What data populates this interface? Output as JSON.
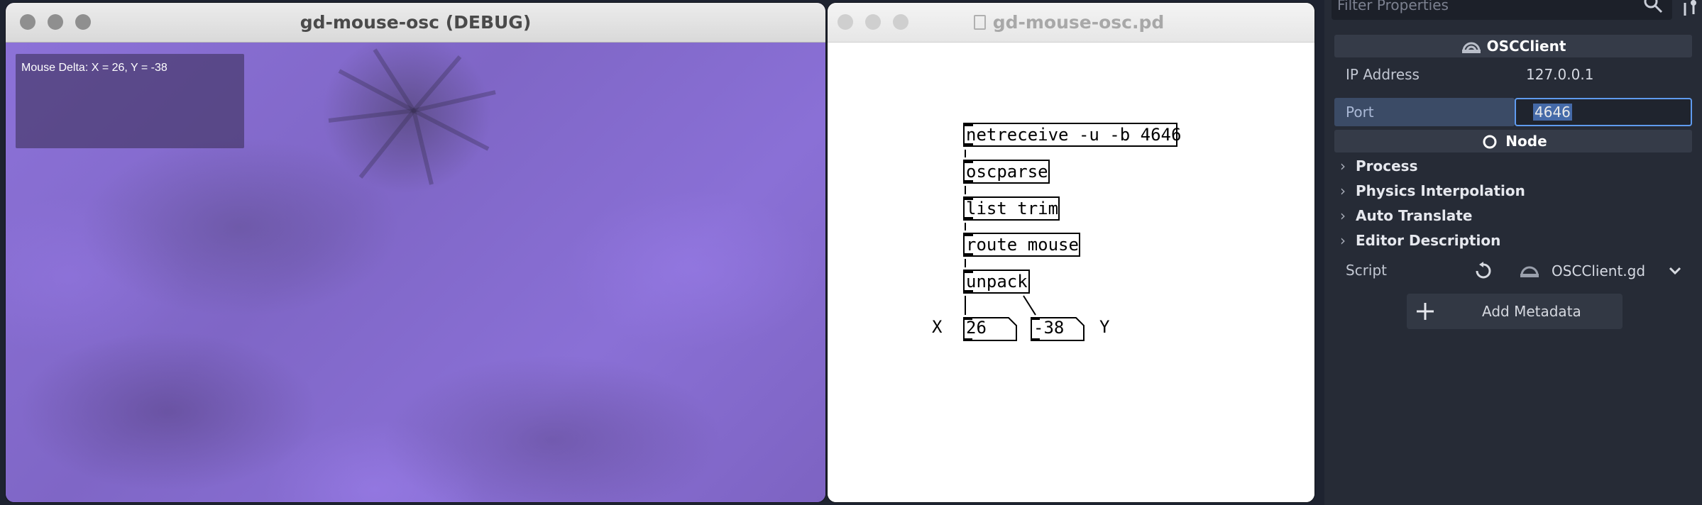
{
  "debug_window": {
    "title": "gd-mouse-osc (DEBUG)",
    "overlay_text": "Mouse Delta: X = 26, Y = -38"
  },
  "pd_window": {
    "title": "gd-mouse-osc.pd",
    "objects": {
      "netreceive": "netreceive -u -b 4646",
      "oscparse": "oscparse",
      "list_trim": "list trim",
      "route": "route mouse",
      "unpack": "unpack"
    },
    "number_x": "26",
    "number_y": "-38",
    "label_x": "X",
    "label_y": "Y"
  },
  "inspector": {
    "filter_placeholder": "Filter Properties",
    "class_header": "OSCClient",
    "ip_label": "IP Address",
    "ip_value": "127.0.0.1",
    "port_label": "Port",
    "port_value": "4646",
    "node_header": "Node",
    "categories": [
      "Process",
      "Physics Interpolation",
      "Auto Translate",
      "Editor Description"
    ],
    "script_label": "Script",
    "script_value": "OSCClient.gd",
    "add_metadata_label": "Add Metadata"
  },
  "colors": {
    "accent_focus": "#5f9bef",
    "viewport_purple": "#8a6fd4",
    "inspector_bg": "#262b36"
  }
}
